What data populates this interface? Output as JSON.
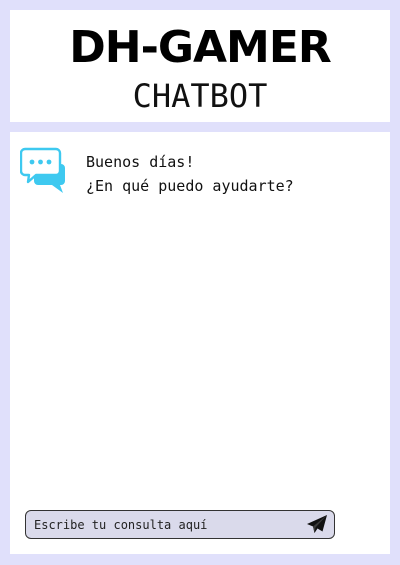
{
  "header": {
    "title": "DH-GAMER",
    "subtitle": "CHATBOT"
  },
  "chat": {
    "avatar_icon": "chat-bubbles-icon",
    "avatar_color": "#3ec9f0",
    "messages": [
      {
        "sender": "bot",
        "lines": [
          "Buenos días!",
          "¿En qué puedo ayudarte?"
        ]
      }
    ]
  },
  "input": {
    "placeholder": "Escribe tu consulta aquí",
    "value": "",
    "send_icon": "paper-plane-icon"
  },
  "colors": {
    "page_background": "#e0e0fb",
    "panel_background": "#ffffff",
    "input_background": "#dadaeb"
  }
}
